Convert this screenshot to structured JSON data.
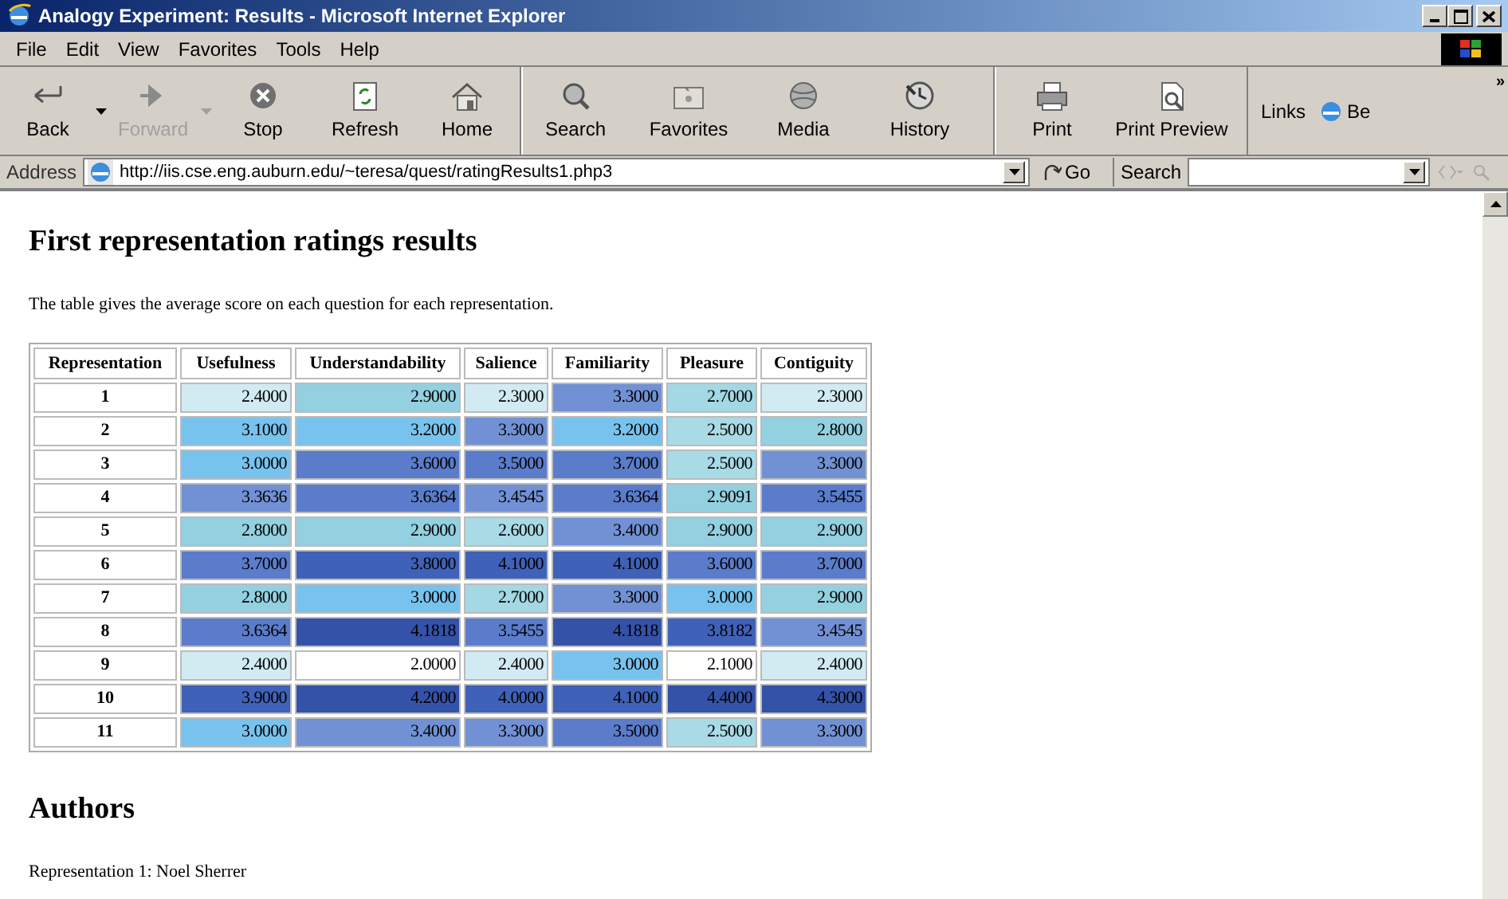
{
  "window": {
    "title": "Analogy Experiment: Results - Microsoft Internet Explorer"
  },
  "menu": [
    "File",
    "Edit",
    "View",
    "Favorites",
    "Tools",
    "Help"
  ],
  "toolbar": {
    "groups": [
      [
        {
          "label": "Back",
          "kind": "back",
          "disabled": false,
          "dropdown": true
        },
        {
          "label": "Forward",
          "kind": "forward",
          "disabled": true,
          "dropdown": true
        },
        {
          "label": "Stop",
          "kind": "stop",
          "disabled": false,
          "dropdown": false
        },
        {
          "label": "Refresh",
          "kind": "refresh",
          "disabled": false,
          "dropdown": false
        },
        {
          "label": "Home",
          "kind": "home",
          "disabled": false,
          "dropdown": false
        }
      ],
      [
        {
          "label": "Search",
          "kind": "search",
          "disabled": false,
          "dropdown": false
        },
        {
          "label": "Favorites",
          "kind": "favorites",
          "disabled": false,
          "dropdown": false
        },
        {
          "label": "Media",
          "kind": "media",
          "disabled": false,
          "dropdown": false
        },
        {
          "label": "History",
          "kind": "history",
          "disabled": false,
          "dropdown": false
        }
      ],
      [
        {
          "label": "Print",
          "kind": "print",
          "disabled": false,
          "dropdown": false
        },
        {
          "label": "Print Preview",
          "kind": "preview",
          "disabled": false,
          "dropdown": false
        }
      ]
    ],
    "links_label": "Links",
    "link": "Be",
    "overflow": "»"
  },
  "address_bar": {
    "label": "Address",
    "url": "http://iis.cse.eng.auburn.edu/~teresa/quest/ratingResults1.php3",
    "go": "Go",
    "search_label": "Search"
  },
  "page": {
    "heading": "First representation ratings results",
    "intro": "The table gives the average score on each question for each representation.",
    "table": {
      "columns": [
        "Representation",
        "Usefulness",
        "Understandability",
        "Salience",
        "Familiarity",
        "Pleasure",
        "Contiguity"
      ],
      "rows": [
        {
          "cells": [
            {
              "text": "1"
            },
            {
              "text": "2.4000",
              "color": "#d2ebf3"
            },
            {
              "text": "2.9000",
              "color": "#93d0e0"
            },
            {
              "text": "2.3000",
              "color": "#d2ebf3"
            },
            {
              "text": "3.3000",
              "color": "#7191d4"
            },
            {
              "text": "2.7000",
              "color": "#a3d8e4"
            },
            {
              "text": "2.3000",
              "color": "#d2ebf3"
            }
          ]
        },
        {
          "cells": [
            {
              "text": "2"
            },
            {
              "text": "3.1000",
              "color": "#78c3ee"
            },
            {
              "text": "3.2000",
              "color": "#78c3ee"
            },
            {
              "text": "3.3000",
              "color": "#7191d4"
            },
            {
              "text": "3.2000",
              "color": "#78c3ee"
            },
            {
              "text": "2.5000",
              "color": "#a9dbe6"
            },
            {
              "text": "2.8000",
              "color": "#93d0e0"
            }
          ]
        },
        {
          "cells": [
            {
              "text": "3"
            },
            {
              "text": "3.0000",
              "color": "#78c3ee"
            },
            {
              "text": "3.6000",
              "color": "#5a7ccb"
            },
            {
              "text": "3.5000",
              "color": "#5a7ccb"
            },
            {
              "text": "3.7000",
              "color": "#5a7ccb"
            },
            {
              "text": "2.5000",
              "color": "#a9dbe6"
            },
            {
              "text": "3.3000",
              "color": "#7191d4"
            }
          ]
        },
        {
          "cells": [
            {
              "text": "4"
            },
            {
              "text": "3.3636",
              "color": "#7191d4"
            },
            {
              "text": "3.6364",
              "color": "#5a7ccb"
            },
            {
              "text": "3.4545",
              "color": "#7191d4"
            },
            {
              "text": "3.6364",
              "color": "#5a7ccb"
            },
            {
              "text": "2.9091",
              "color": "#93d0e0"
            },
            {
              "text": "3.5455",
              "color": "#5a7ccb"
            }
          ]
        },
        {
          "cells": [
            {
              "text": "5"
            },
            {
              "text": "2.8000",
              "color": "#93d0e0"
            },
            {
              "text": "2.9000",
              "color": "#93d0e0"
            },
            {
              "text": "2.6000",
              "color": "#a9dbe6"
            },
            {
              "text": "3.4000",
              "color": "#7191d4"
            },
            {
              "text": "2.9000",
              "color": "#93d0e0"
            },
            {
              "text": "2.9000",
              "color": "#93d0e0"
            }
          ]
        },
        {
          "cells": [
            {
              "text": "6"
            },
            {
              "text": "3.7000",
              "color": "#5a7ccb"
            },
            {
              "text": "3.8000",
              "color": "#3f61b8"
            },
            {
              "text": "4.1000",
              "color": "#3f61b8"
            },
            {
              "text": "4.1000",
              "color": "#3f61b8"
            },
            {
              "text": "3.6000",
              "color": "#5a7ccb"
            },
            {
              "text": "3.7000",
              "color": "#5a7ccb"
            }
          ]
        },
        {
          "cells": [
            {
              "text": "7"
            },
            {
              "text": "2.8000",
              "color": "#93d0e0"
            },
            {
              "text": "3.0000",
              "color": "#78c3ee"
            },
            {
              "text": "2.7000",
              "color": "#a3d8e4"
            },
            {
              "text": "3.3000",
              "color": "#7191d4"
            },
            {
              "text": "3.0000",
              "color": "#78c3ee"
            },
            {
              "text": "2.9000",
              "color": "#93d0e0"
            }
          ]
        },
        {
          "cells": [
            {
              "text": "8"
            },
            {
              "text": "3.6364",
              "color": "#5a7ccb"
            },
            {
              "text": "4.1818",
              "color": "#3452a8"
            },
            {
              "text": "3.5455",
              "color": "#5a7ccb"
            },
            {
              "text": "4.1818",
              "color": "#3452a8"
            },
            {
              "text": "3.8182",
              "color": "#3f61b8"
            },
            {
              "text": "3.4545",
              "color": "#7191d4"
            }
          ]
        },
        {
          "cells": [
            {
              "text": "9"
            },
            {
              "text": "2.4000",
              "color": "#d2ebf3"
            },
            {
              "text": "2.0000",
              "color": "#ffffff"
            },
            {
              "text": "2.4000",
              "color": "#d2ebf3"
            },
            {
              "text": "3.0000",
              "color": "#78c3ee"
            },
            {
              "text": "2.1000",
              "color": "#ffffff"
            },
            {
              "text": "2.4000",
              "color": "#d2ebf3"
            }
          ]
        },
        {
          "cells": [
            {
              "text": "10"
            },
            {
              "text": "3.9000",
              "color": "#3f61b8"
            },
            {
              "text": "4.2000",
              "color": "#3452a8"
            },
            {
              "text": "4.0000",
              "color": "#3f61b8"
            },
            {
              "text": "4.1000",
              "color": "#3f61b8"
            },
            {
              "text": "4.4000",
              "color": "#3452a8"
            },
            {
              "text": "4.3000",
              "color": "#3452a8"
            }
          ]
        },
        {
          "cells": [
            {
              "text": "11"
            },
            {
              "text": "3.0000",
              "color": "#78c3ee"
            },
            {
              "text": "3.4000",
              "color": "#7191d4"
            },
            {
              "text": "3.3000",
              "color": "#7191d4"
            },
            {
              "text": "3.5000",
              "color": "#5a7ccb"
            },
            {
              "text": "2.5000",
              "color": "#a9dbe6"
            },
            {
              "text": "3.3000",
              "color": "#7191d4"
            }
          ]
        }
      ]
    },
    "authors_heading": "Authors",
    "authors": [
      "Representation 1: Noel Sherrer"
    ]
  }
}
